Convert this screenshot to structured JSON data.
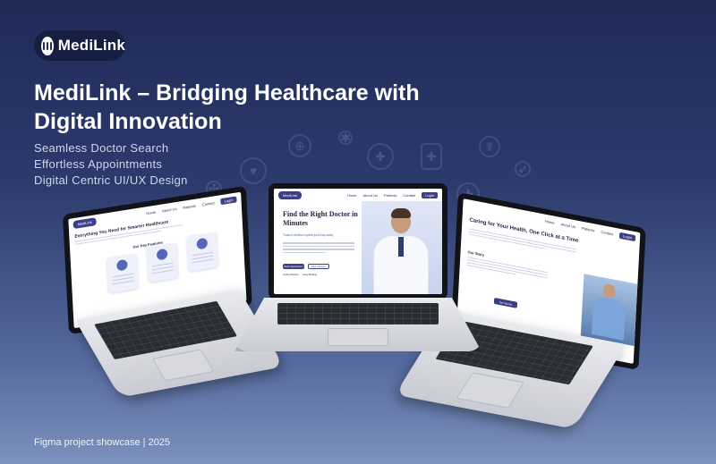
{
  "brand": {
    "name": "MediLink"
  },
  "headline": {
    "line1": "MediLink – Bridging Healthcare with",
    "line2": "Digital Innovation"
  },
  "features": [
    "Seamless Doctor Search",
    "Effortless Appointments",
    "Digital Centric UI/UX Design"
  ],
  "footer": {
    "note": "Figma project showcase | 2025"
  },
  "mockups": {
    "nav_links": [
      "Home",
      "About Us",
      "Patients",
      "Contact"
    ],
    "login_label": "Login",
    "center": {
      "brand": "MediLink",
      "hero_title": "Find the Right Doctor in Minutes",
      "hero_sub": "Trusted medical experts just a tap away",
      "primary_btn": "Book Appointment",
      "secondary_btn": "Find a Doctor",
      "stats": [
        "Verified Doctors",
        "Easy Booking"
      ]
    },
    "left": {
      "brand": "MediLink",
      "title": "Everything You Need for Smarter Healthcare",
      "section": "Our Key Features"
    },
    "right": {
      "title": "Caring for Your Health, One Click at a Time",
      "story": "Our Story",
      "button": "Get Started"
    }
  },
  "colors": {
    "background_top": "#1f2a57",
    "background_bottom": "#7d91bd",
    "accent": "#3b3f86"
  }
}
